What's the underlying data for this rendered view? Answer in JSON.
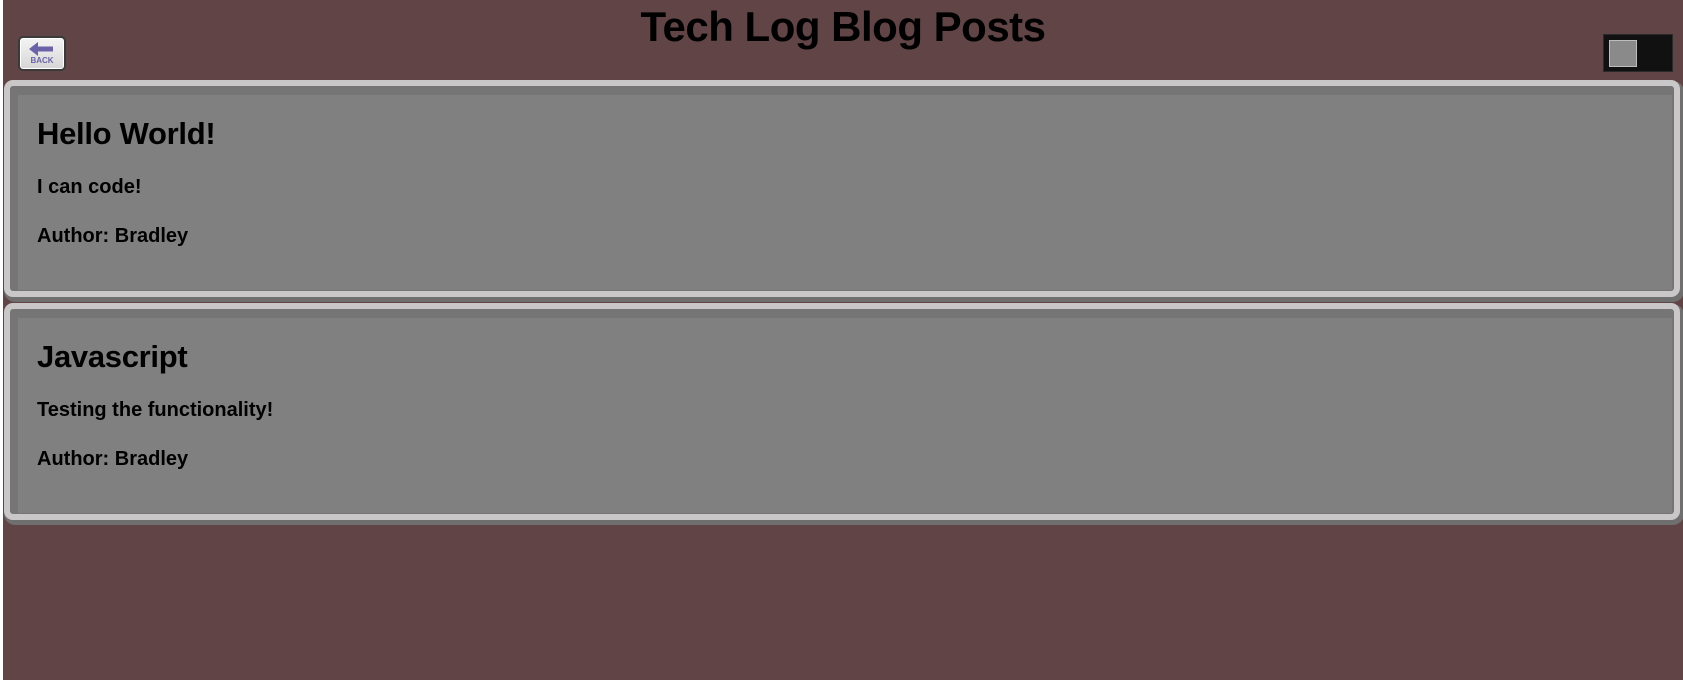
{
  "header": {
    "title": "Tech Log Blog Posts",
    "back_label": "BACK",
    "back_icon": "arrow-left-icon",
    "theme_toggle": {
      "state": "off"
    }
  },
  "posts": [
    {
      "title": "Hello World!",
      "body": "I can code!",
      "author": "Author: Bradley"
    },
    {
      "title": "Javascript",
      "body": "Testing the functionality!",
      "author": "Author: Bradley"
    }
  ],
  "colors": {
    "page_background": "#614446",
    "card_background": "#808080",
    "card_border": "#c9c7c7",
    "back_icon": "#6a63a8",
    "toggle_track": "#111111",
    "toggle_knob": "#8a8a8a"
  }
}
